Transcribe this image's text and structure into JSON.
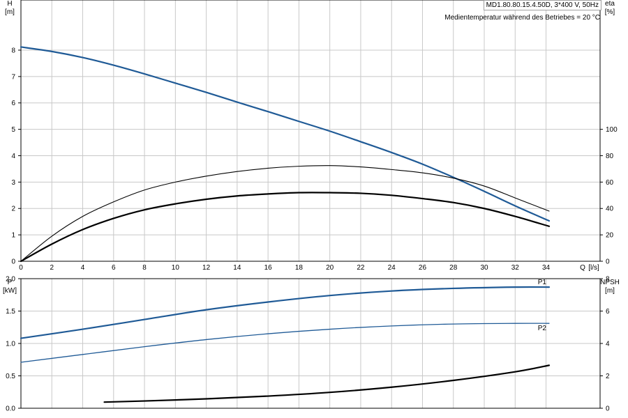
{
  "header": {
    "pump_label": "MD1.80.80.15.4.50D, 3*400 V, 50Hz",
    "medium_note": "Medientemperatur während des Betriebes = 20 °C"
  },
  "chart_data": [
    {
      "type": "line",
      "panel": "head-efficiency",
      "x_label_text": "Q",
      "x_unit_text": "[l/s]",
      "xlim": [
        0,
        37.5
      ],
      "x_ticks": [
        0,
        2,
        4,
        6,
        8,
        10,
        12,
        14,
        16,
        18,
        20,
        22,
        24,
        26,
        28,
        30,
        32,
        34
      ],
      "left_axis": {
        "label": "H",
        "unit": "[m]",
        "lim": [
          0,
          9.9
        ],
        "ticks": [
          0,
          1,
          2,
          3,
          4,
          5,
          6,
          7,
          8
        ]
      },
      "right_axis": {
        "label": "eta",
        "unit": "[%]",
        "lim": [
          0,
          198
        ],
        "ticks": [
          0,
          20,
          40,
          60,
          80,
          100
        ]
      },
      "grid": true,
      "series": [
        {
          "role": "head",
          "axis": "left",
          "color": "#1f5a96",
          "x": [
            0,
            2,
            4,
            6,
            8,
            10,
            12,
            14,
            16,
            18,
            20,
            22,
            24,
            26,
            28,
            30,
            32,
            34.2
          ],
          "y": [
            8.12,
            7.95,
            7.72,
            7.43,
            7.1,
            6.75,
            6.4,
            6.03,
            5.67,
            5.3,
            4.93,
            4.53,
            4.12,
            3.68,
            3.18,
            2.65,
            2.1,
            1.53
          ]
        },
        {
          "role": "hydraulic efficiency",
          "axis": "right",
          "color": "#000000",
          "x": [
            0,
            2,
            4,
            6,
            8,
            10,
            12,
            14,
            16,
            18,
            20,
            22,
            24,
            26,
            28,
            30,
            32,
            34.2
          ],
          "y": [
            0,
            19,
            34,
            45,
            54,
            60,
            64.5,
            68,
            70.5,
            72,
            72.5,
            71.5,
            69.5,
            67,
            63,
            57,
            48,
            38
          ]
        },
        {
          "role": "total efficiency",
          "axis": "right",
          "color": "#000000",
          "x": [
            0,
            2,
            4,
            6,
            8,
            10,
            12,
            14,
            16,
            18,
            20,
            22,
            24,
            26,
            28,
            30,
            32,
            34.2
          ],
          "y": [
            0,
            13,
            24,
            32.5,
            39,
            43.5,
            47,
            49.5,
            51,
            52,
            52,
            51.5,
            50,
            47.5,
            44.5,
            40,
            34,
            26.5
          ]
        }
      ]
    },
    {
      "type": "line",
      "panel": "power-npsh",
      "xlim": [
        0,
        37.5
      ],
      "left_axis": {
        "label": "P",
        "unit": "[kW]",
        "lim": [
          0,
          2.0
        ],
        "ticks": [
          "0.0",
          "0.5",
          "1.0",
          "1.5",
          "2.0"
        ]
      },
      "right_axis": {
        "label": "NPSH",
        "unit": "[m]",
        "lim": [
          0,
          8.0
        ],
        "ticks": [
          0,
          2,
          4,
          6,
          8
        ]
      },
      "grid": true,
      "series": [
        {
          "name": "P1",
          "axis": "left",
          "color": "#1f5a96",
          "x": [
            0,
            4,
            8,
            12,
            16,
            20,
            24,
            28,
            32,
            34.2
          ],
          "y": [
            1.08,
            1.22,
            1.37,
            1.52,
            1.64,
            1.74,
            1.81,
            1.85,
            1.87,
            1.87
          ]
        },
        {
          "name": "P2",
          "axis": "left",
          "color": "#1f5a96",
          "x": [
            0,
            4,
            8,
            12,
            16,
            20,
            24,
            28,
            32,
            34.2
          ],
          "y": [
            0.71,
            0.83,
            0.95,
            1.06,
            1.15,
            1.22,
            1.27,
            1.3,
            1.31,
            1.31
          ]
        },
        {
          "role": "NPSH",
          "axis": "right",
          "color": "#000000",
          "x": [
            5.4,
            8,
            12,
            16,
            20,
            24,
            28,
            32,
            34.2
          ],
          "y": [
            0.38,
            0.45,
            0.58,
            0.75,
            0.98,
            1.3,
            1.72,
            2.25,
            2.65
          ]
        }
      ]
    }
  ]
}
